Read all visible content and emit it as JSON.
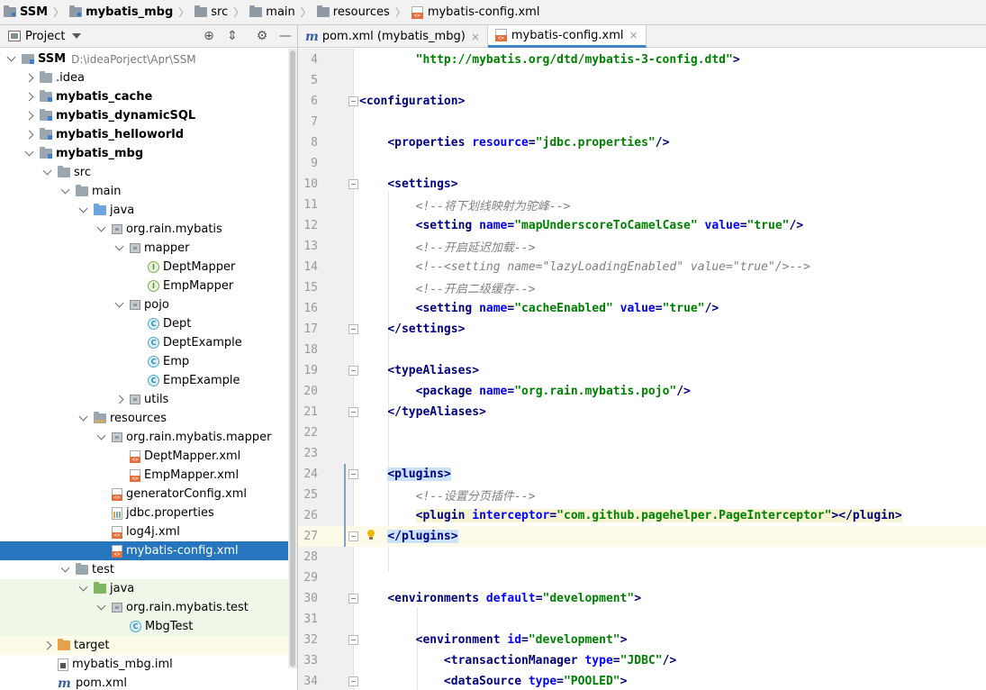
{
  "breadcrumbs": [
    {
      "label": "SSM",
      "icon": "folder-module-icon",
      "bold": true
    },
    {
      "label": "mybatis_mbg",
      "icon": "folder-module-icon",
      "bold": true
    },
    {
      "label": "src",
      "icon": "folder-icon",
      "bold": false
    },
    {
      "label": "main",
      "icon": "folder-icon",
      "bold": false
    },
    {
      "label": "resources",
      "icon": "resources-folder-icon",
      "bold": false
    },
    {
      "label": "mybatis-config.xml",
      "icon": "xml-file-icon",
      "bold": false
    }
  ],
  "project_panel": {
    "title": "Project",
    "buttons": [
      "locate-icon",
      "collapse-all-icon",
      "gear-icon",
      "hide-icon"
    ]
  },
  "tree": [
    {
      "depth": 0,
      "chev": "open",
      "icon": "proj",
      "label": "SSM",
      "bold": true,
      "path": "D:\\ideaPorject\\Apr\\SSM"
    },
    {
      "depth": 1,
      "chev": "closed",
      "icon": "folder",
      "label": ".idea"
    },
    {
      "depth": 1,
      "chev": "closed",
      "icon": "folder mod",
      "label": "mybatis_cache",
      "bold": true
    },
    {
      "depth": 1,
      "chev": "closed",
      "icon": "folder mod",
      "label": "mybatis_dynamicSQL",
      "bold": true
    },
    {
      "depth": 1,
      "chev": "closed",
      "icon": "folder mod",
      "label": "mybatis_helloworld",
      "bold": true
    },
    {
      "depth": 1,
      "chev": "open",
      "icon": "folder mod",
      "label": "mybatis_mbg",
      "bold": true
    },
    {
      "depth": 2,
      "chev": "open",
      "icon": "folder",
      "label": "src"
    },
    {
      "depth": 3,
      "chev": "open",
      "icon": "folder",
      "label": "main"
    },
    {
      "depth": 4,
      "chev": "open",
      "icon": "folder src",
      "label": "java"
    },
    {
      "depth": 5,
      "chev": "open",
      "icon": "pkg",
      "label": "org.rain.mybatis"
    },
    {
      "depth": 6,
      "chev": "open",
      "icon": "pkg",
      "label": "mapper"
    },
    {
      "depth": 7,
      "chev": "",
      "icon": "intf",
      "label": "DeptMapper"
    },
    {
      "depth": 7,
      "chev": "",
      "icon": "intf",
      "label": "EmpMapper"
    },
    {
      "depth": 6,
      "chev": "open",
      "icon": "pkg",
      "label": "pojo"
    },
    {
      "depth": 7,
      "chev": "",
      "icon": "cls",
      "label": "Dept"
    },
    {
      "depth": 7,
      "chev": "",
      "icon": "cls",
      "label": "DeptExample"
    },
    {
      "depth": 7,
      "chev": "",
      "icon": "cls",
      "label": "Emp"
    },
    {
      "depth": 7,
      "chev": "",
      "icon": "cls",
      "label": "EmpExample"
    },
    {
      "depth": 6,
      "chev": "closed",
      "icon": "pkg",
      "label": "utils"
    },
    {
      "depth": 4,
      "chev": "open",
      "icon": "folder res",
      "label": "resources"
    },
    {
      "depth": 5,
      "chev": "open",
      "icon": "pkg",
      "label": "org.rain.mybatis.mapper"
    },
    {
      "depth": 6,
      "chev": "",
      "icon": "xml",
      "label": "DeptMapper.xml"
    },
    {
      "depth": 6,
      "chev": "",
      "icon": "xml",
      "label": "EmpMapper.xml"
    },
    {
      "depth": 5,
      "chev": "",
      "icon": "xml",
      "label": "generatorConfig.xml"
    },
    {
      "depth": 5,
      "chev": "",
      "icon": "props",
      "label": "jdbc.properties"
    },
    {
      "depth": 5,
      "chev": "",
      "icon": "xml",
      "label": "log4j.xml"
    },
    {
      "depth": 5,
      "chev": "",
      "icon": "xml",
      "label": "mybatis-config.xml",
      "selected": true
    },
    {
      "depth": 3,
      "chev": "open",
      "icon": "folder",
      "label": "test"
    },
    {
      "depth": 4,
      "chev": "open",
      "icon": "folder tsrc",
      "label": "java",
      "test": true
    },
    {
      "depth": 5,
      "chev": "open",
      "icon": "pkg",
      "label": "org.rain.mybatis.test",
      "test": true
    },
    {
      "depth": 6,
      "chev": "",
      "icon": "cls",
      "label": "MbgTest",
      "test": true
    },
    {
      "depth": 2,
      "chev": "closed",
      "icon": "folder excl",
      "label": "target",
      "excl": true
    },
    {
      "depth": 2,
      "chev": "",
      "icon": "iml",
      "label": "mybatis_mbg.iml"
    },
    {
      "depth": 2,
      "chev": "",
      "icon": "mvn",
      "label": "pom.xml"
    }
  ],
  "tabs": [
    {
      "label": "pom.xml (mybatis_mbg)",
      "icon": "maven-icon",
      "active": false
    },
    {
      "label": "mybatis-config.xml",
      "icon": "xml-file-icon",
      "active": true
    }
  ],
  "editor": {
    "current_line": 27,
    "lines": [
      {
        "n": "4",
        "tokens": [
          [
            "plain",
            "        "
          ],
          [
            "av",
            "\"http://mybatis.org/dtd/mybatis-3-config.dtd\""
          ],
          [
            "tg",
            ">"
          ]
        ]
      },
      {
        "n": "5",
        "tokens": []
      },
      {
        "n": "6",
        "fold": true,
        "tokens": [
          [
            "tg",
            "<configuration>"
          ]
        ]
      },
      {
        "n": "7",
        "tokens": []
      },
      {
        "n": "8",
        "tokens": [
          [
            "plain",
            "    "
          ],
          [
            "tg",
            "<properties "
          ],
          [
            "an",
            "resource"
          ],
          [
            "tg",
            "="
          ],
          [
            "av",
            "\"jdbc.properties\""
          ],
          [
            "tg",
            "/>"
          ]
        ]
      },
      {
        "n": "9",
        "tokens": []
      },
      {
        "n": "10",
        "fold": true,
        "tokens": [
          [
            "plain",
            "    "
          ],
          [
            "tg",
            "<settings>"
          ]
        ]
      },
      {
        "n": "11",
        "tokens": [
          [
            "plain",
            "        "
          ],
          [
            "cm",
            "<!--将下划线映射为驼峰-->"
          ]
        ]
      },
      {
        "n": "12",
        "tokens": [
          [
            "plain",
            "        "
          ],
          [
            "tg",
            "<setting "
          ],
          [
            "an",
            "name"
          ],
          [
            "tg",
            "="
          ],
          [
            "av",
            "\"mapUnderscoreToCamelCase\""
          ],
          [
            "tg",
            " "
          ],
          [
            "an",
            "value"
          ],
          [
            "tg",
            "="
          ],
          [
            "av",
            "\"true\""
          ],
          [
            "tg",
            "/>"
          ]
        ]
      },
      {
        "n": "13",
        "tokens": [
          [
            "plain",
            "        "
          ],
          [
            "cm",
            "<!--开启延迟加载-->"
          ]
        ]
      },
      {
        "n": "14",
        "tokens": [
          [
            "plain",
            "        "
          ],
          [
            "cm",
            "<!--<setting name=\"lazyLoadingEnabled\" value=\"true\"/>-->"
          ]
        ]
      },
      {
        "n": "15",
        "tokens": [
          [
            "plain",
            "        "
          ],
          [
            "cm",
            "<!--开启二级缓存-->"
          ]
        ]
      },
      {
        "n": "16",
        "tokens": [
          [
            "plain",
            "        "
          ],
          [
            "tg",
            "<setting "
          ],
          [
            "an",
            "name"
          ],
          [
            "tg",
            "="
          ],
          [
            "av",
            "\"cacheEnabled\""
          ],
          [
            "tg",
            " "
          ],
          [
            "an",
            "value"
          ],
          [
            "tg",
            "="
          ],
          [
            "av",
            "\"true\""
          ],
          [
            "tg",
            "/>"
          ]
        ]
      },
      {
        "n": "17",
        "fold": true,
        "tokens": [
          [
            "plain",
            "    "
          ],
          [
            "tg",
            "</settings>"
          ]
        ]
      },
      {
        "n": "18",
        "tokens": []
      },
      {
        "n": "19",
        "fold": true,
        "tokens": [
          [
            "plain",
            "    "
          ],
          [
            "tg",
            "<typeAliases>"
          ]
        ]
      },
      {
        "n": "20",
        "tokens": [
          [
            "plain",
            "        "
          ],
          [
            "tg",
            "<package "
          ],
          [
            "an",
            "name"
          ],
          [
            "tg",
            "="
          ],
          [
            "av",
            "\"org.rain.mybatis.pojo\""
          ],
          [
            "tg",
            "/>"
          ]
        ]
      },
      {
        "n": "21",
        "fold": true,
        "tokens": [
          [
            "plain",
            "    "
          ],
          [
            "tg",
            "</typeAliases>"
          ]
        ]
      },
      {
        "n": "22",
        "tokens": []
      },
      {
        "n": "23",
        "tokens": []
      },
      {
        "n": "24",
        "fold": true,
        "changed": true,
        "tokens": [
          [
            "plain",
            "    "
          ],
          [
            "tg hl",
            "<plugins>"
          ]
        ]
      },
      {
        "n": "25",
        "changed": true,
        "tokens": [
          [
            "plain",
            "        "
          ],
          [
            "cm",
            "<!--设置分页插件-->"
          ]
        ]
      },
      {
        "n": "26",
        "changed": true,
        "tokens": [
          [
            "plain",
            "        "
          ],
          [
            "tg pl",
            "<plugin "
          ],
          [
            "an pl",
            "interceptor"
          ],
          [
            "tg pl",
            "="
          ],
          [
            "av pl",
            "\"com.github.pagehelper.PageInterceptor\""
          ],
          [
            "tg pl",
            "></plugin>"
          ]
        ]
      },
      {
        "n": "27",
        "fold": true,
        "changed": true,
        "bulb": true,
        "tokens": [
          [
            "plain",
            "    "
          ],
          [
            "tg hl",
            "</plugins>"
          ]
        ]
      },
      {
        "n": "28",
        "tokens": []
      },
      {
        "n": "29",
        "tokens": []
      },
      {
        "n": "30",
        "fold": true,
        "tokens": [
          [
            "plain",
            "    "
          ],
          [
            "tg",
            "<environments "
          ],
          [
            "an",
            "default"
          ],
          [
            "tg",
            "="
          ],
          [
            "av",
            "\"development\""
          ],
          [
            "tg",
            ">"
          ]
        ]
      },
      {
        "n": "31",
        "tokens": []
      },
      {
        "n": "32",
        "fold": true,
        "tokens": [
          [
            "plain",
            "        "
          ],
          [
            "tg",
            "<environment "
          ],
          [
            "an",
            "id"
          ],
          [
            "tg",
            "="
          ],
          [
            "av",
            "\"development\""
          ],
          [
            "tg",
            ">"
          ]
        ]
      },
      {
        "n": "33",
        "tokens": [
          [
            "plain",
            "            "
          ],
          [
            "tg",
            "<transactionManager "
          ],
          [
            "an",
            "type"
          ],
          [
            "tg",
            "="
          ],
          [
            "av",
            "\"JDBC\""
          ],
          [
            "tg",
            "/>"
          ]
        ]
      },
      {
        "n": "34",
        "fold": true,
        "tokens": [
          [
            "plain",
            "            "
          ],
          [
            "tg",
            "<dataSource "
          ],
          [
            "an",
            "type"
          ],
          [
            "tg",
            "="
          ],
          [
            "av",
            "\"POOLED\""
          ],
          [
            "tg",
            ">"
          ]
        ]
      }
    ]
  }
}
